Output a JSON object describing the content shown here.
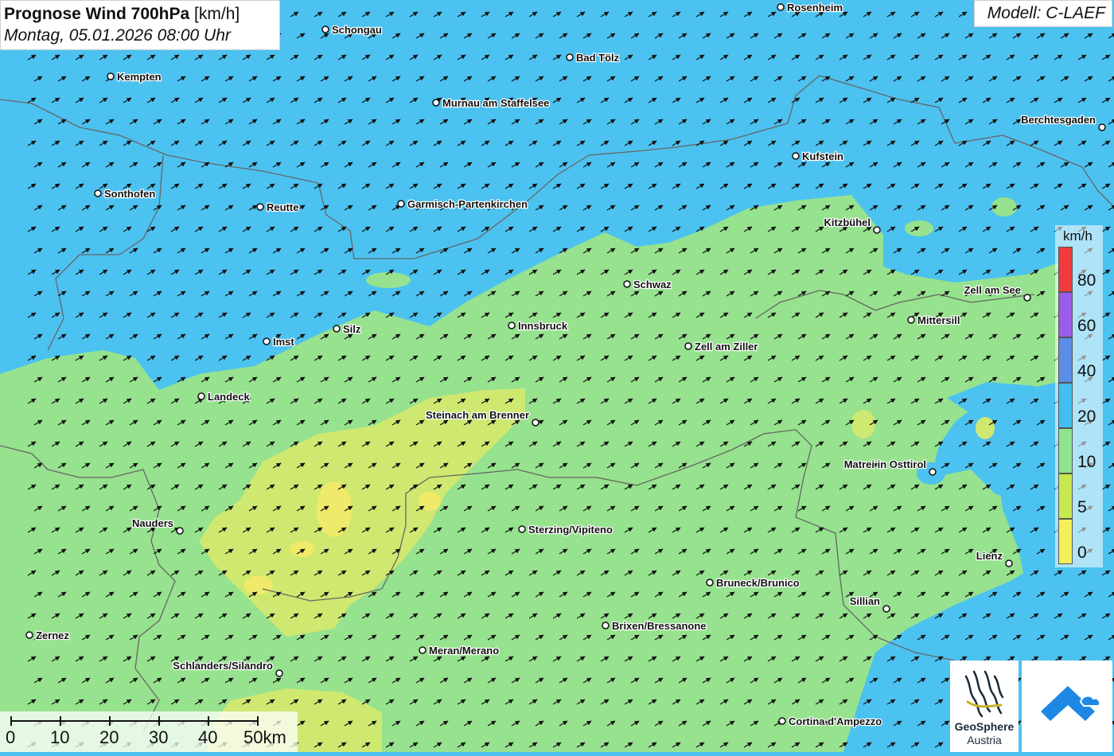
{
  "title": {
    "main": "Prognose Wind 700hPa",
    "unit": "[km/h]",
    "subtitle": "Montag, 05.01.2026 08:00 Uhr"
  },
  "model": "Modell: C-LAEF",
  "legend": {
    "unit": "km/h",
    "bins": [
      {
        "label": "80",
        "color": "#ef3b3b"
      },
      {
        "label": "60",
        "color": "#9b5ce8"
      },
      {
        "label": "40",
        "color": "#5a8ee8"
      },
      {
        "label": "20",
        "color": "#40bff0"
      },
      {
        "label": "10",
        "color": "#8ee58e"
      },
      {
        "label": "5",
        "color": "#c8e850"
      },
      {
        "label": "0",
        "color": "#f5ef5a"
      }
    ]
  },
  "scale": {
    "labels": [
      "0",
      "10",
      "20",
      "30",
      "40",
      "50km"
    ]
  },
  "logo": {
    "line1": "GeoSphere",
    "line2": "Austria"
  },
  "colors": {
    "wind_20_40": "#4cc2f0",
    "wind_10_20": "#96e28e",
    "wind_5_10": "#cfe870",
    "wind_0_5": "#f0ea6a",
    "border": "#666666",
    "arrow": "#111111",
    "accent_blue": "#1e88e5"
  },
  "wind_arrow_direction": "toward north-east",
  "cities": [
    "Rosenheim",
    "Schongau",
    "Bad Tölz",
    "Kempten",
    "Murnau am Staffelsee",
    "Berchtesgaden",
    "Kufstein",
    "Sonthofen",
    "Reutte",
    "Garmisch-Partenkirchen",
    "Kitzbühel",
    "Schwaz",
    "Zell am See",
    "Mittersill",
    "Innsbruck",
    "Silz",
    "Imst",
    "Zell am Ziller",
    "Landeck",
    "Steinach am Brenner",
    "Matrei in Osttirol",
    "Nauders",
    "Sterzing/Vipiteno",
    "Lienz",
    "Bruneck/Brunico",
    "Sillian",
    "Brixen/Bressanone",
    "Zernez",
    "Meran/Merano",
    "Schlanders/Silandro",
    "Cortina d'Ampezzo"
  ]
}
